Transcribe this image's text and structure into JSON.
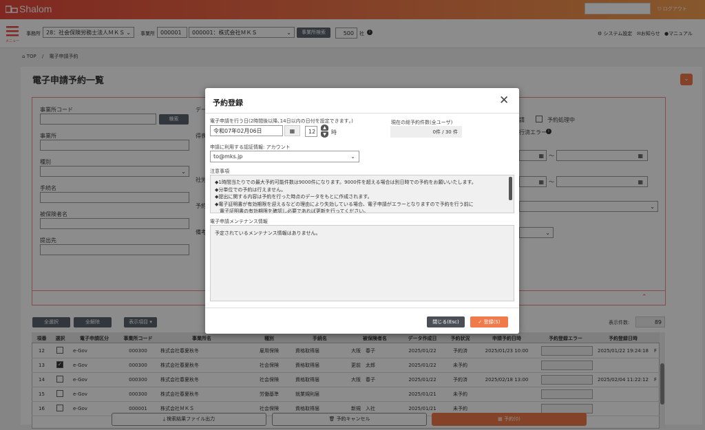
{
  "header": {
    "logo": "Shalom",
    "logout": "ログアウト"
  },
  "toolbar": {
    "menu_label": "メニュー",
    "office_label": "事務所",
    "office_value": "28：社会保険労務士法人ＭＫＳ",
    "site_label": "事業所",
    "site_code": "000001",
    "site_value": "000001：株式会社ＭＫＳ",
    "site_search": "事業所検索",
    "count": "500",
    "count_unit": "社",
    "system_settings": "システム設定",
    "notices": "お知らせ",
    "manual": "マニュアル"
  },
  "breadcrumb": {
    "top": "TOP",
    "sep": "/",
    "current": "電子申請予約"
  },
  "page": {
    "title": "電子申請予約一覧"
  },
  "search": {
    "site_code_label": "事業所コード",
    "search_btn": "検索",
    "site_label": "事業所",
    "type_label": "種別",
    "procedure_label": "手続名",
    "insured_label": "被保険者名",
    "submit_to_label": "提出先",
    "partial_d": "デー",
    "partial_ho": "得喪",
    "partial_sha": "社労",
    "partial_yo": "予約",
    "partial_bi": "備考",
    "status_partial": "請",
    "status_processing": "予約処理中",
    "status_error": "行済エラー",
    "tilde": "～"
  },
  "actions": {
    "select_all": "全選択",
    "deselect_all": "全解除",
    "display_items": "表示項目 ▾",
    "display_count_label": "表示件数:",
    "display_count": "89"
  },
  "table": {
    "headers": [
      "項番",
      "選択",
      "電子申請区分",
      "事業所コード",
      "事業所名",
      "種別",
      "手続名",
      "被保険者名",
      "データ作成日",
      "予約状況",
      "申請予約日時",
      "予約登録エラー",
      "予約登録日時"
    ],
    "rows": [
      {
        "no": "12",
        "checked": false,
        "kind": "e-Gov",
        "code": "000300",
        "site": "株式会社春夏秋冬",
        "type": "雇用保険",
        "proc": "資格取得届",
        "insured": "大阪　春子",
        "created": "2025/01/22",
        "status": "予約済",
        "apply": "2025/01/23 10:00",
        "error": "",
        "registered": "2025/01/22 19:24:18",
        "extra": "F"
      },
      {
        "no": "13",
        "checked": true,
        "kind": "e-Gov",
        "code": "000300",
        "site": "株式会社春夏秋冬",
        "type": "社会保険",
        "proc": "資格取得届",
        "insured": "更前　太郎",
        "created": "2025/01/22",
        "status": "未予約",
        "apply": "",
        "error": "",
        "registered": "",
        "extra": ""
      },
      {
        "no": "14",
        "checked": false,
        "kind": "e-Gov",
        "code": "000300",
        "site": "株式会社春夏秋冬",
        "type": "社会保険",
        "proc": "資格取得届",
        "insured": "大阪　春子",
        "created": "2025/01/22",
        "status": "予約済",
        "apply": "2025/02/18 13:00",
        "error": "",
        "registered": "2025/02/04 11:22:12",
        "extra": "F"
      },
      {
        "no": "15",
        "checked": false,
        "kind": "e-Gov",
        "code": "000300",
        "site": "株式会社春夏秋冬",
        "type": "労働基準",
        "proc": "就業規則届",
        "insured": "",
        "created": "2025/01/21",
        "status": "未予約",
        "apply": "",
        "error": "",
        "registered": "",
        "extra": ""
      },
      {
        "no": "16",
        "checked": false,
        "kind": "e-Gov",
        "code": "000001",
        "site": "株式会社ＭＫＳ",
        "type": "社会保険",
        "proc": "資格取得届",
        "insured": "新規　入社",
        "created": "2025/01/21",
        "status": "未予約",
        "apply": "",
        "error": "",
        "registered": "",
        "extra": ""
      }
    ]
  },
  "footer": {
    "export": "検索結果ファイル出力",
    "cancel": "予約キャンセル",
    "reserve": "予約(0)"
  },
  "modal": {
    "title": "予約登録",
    "date_label": "電子申請を行う日(2時間後以降､14日以内の日付を設定できます｡)",
    "date_value": "令和07年02月06日",
    "hour_value": "12",
    "hour_unit": "時",
    "total_label": "現在の総予約件数(全ユーザ)",
    "total_value": "0件 / 30 件",
    "account_label": "申請に利用する認証情報: アカウント",
    "account_value": "to@mks.jp",
    "notes_label": "注意事項",
    "notes": [
      "◆1時間当たりでの最大予約可能件数は9000件になります。9000件を超える場合は別日時での予約をお願いいたします。",
      "◆分単位での予約は行えません。",
      "◆提出に関する内容は予約を行った時点のデータをもとに作成されます。",
      "◆電子証明書が有効期限を迎えるなどの理由により失効している場合、電子申請がエラーとなりますので予約を行う前に",
      "　電子証明書の有効期限を確認し必要であれば更新を行ってください。"
    ],
    "maint_label": "電子申請メンテナンス情報",
    "maint_text": "予定されているメンテナンス情報はありません。",
    "close_btn": "閉じる(Esc)",
    "register_btn": "登録(S)"
  }
}
